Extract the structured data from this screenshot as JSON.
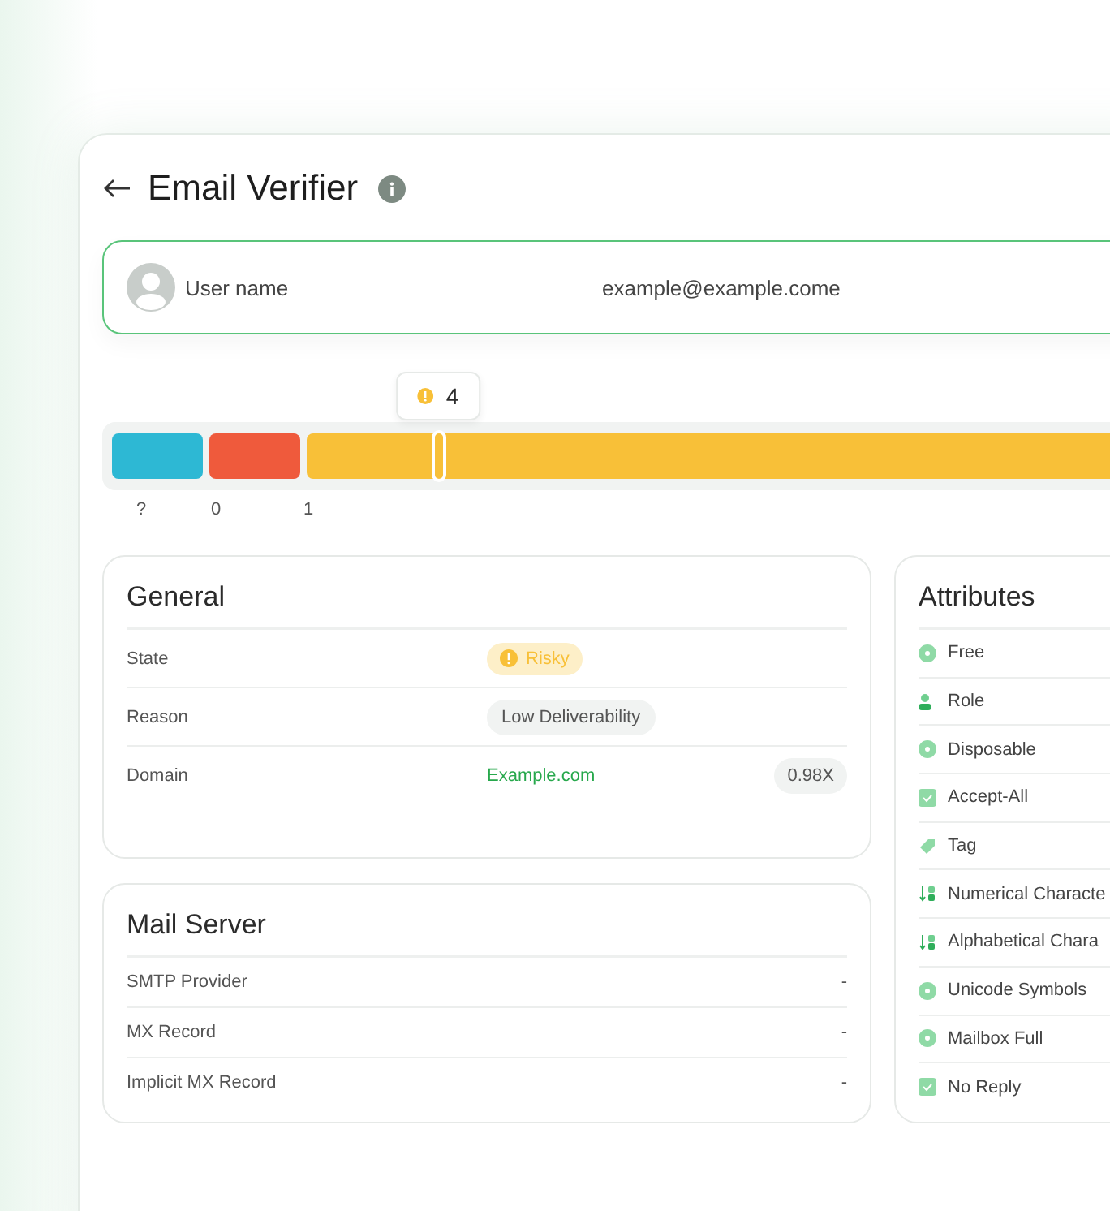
{
  "title": "Email Verifier",
  "user": {
    "name": "User name",
    "email": "example@example.come"
  },
  "distribution": {
    "segments": [
      {
        "label": "?",
        "color": "#2db8d4"
      },
      {
        "label": "0",
        "color": "#ef5a3c"
      },
      {
        "label": "1",
        "color": "#f8c038"
      }
    ],
    "marker": {
      "value": "4",
      "level": 0.32
    }
  },
  "general": {
    "title": "General",
    "rows": [
      {
        "kind": "badge",
        "label": "State",
        "value": "Risky"
      },
      {
        "kind": "chip",
        "label": "Reason",
        "value": "Low Deliverability"
      },
      {
        "kind": "link",
        "label": "Domain",
        "value": "Example.com",
        "extra": "0.98X"
      }
    ]
  },
  "mail_server": {
    "title": "Mail Server",
    "rows": [
      {
        "label": "SMTP Provider",
        "value": "-"
      },
      {
        "label": "MX Record",
        "value": "-"
      },
      {
        "label": "Implicit MX Record",
        "value": "-"
      }
    ]
  },
  "attributes": {
    "title": "Attributes",
    "items": [
      "Free",
      "Role",
      "Disposable",
      "Accept-All",
      "Tag",
      "Numerical Characte",
      "Alphabetical Chara",
      "Unicode Symbols",
      "Mailbox Full",
      "No Reply"
    ]
  }
}
